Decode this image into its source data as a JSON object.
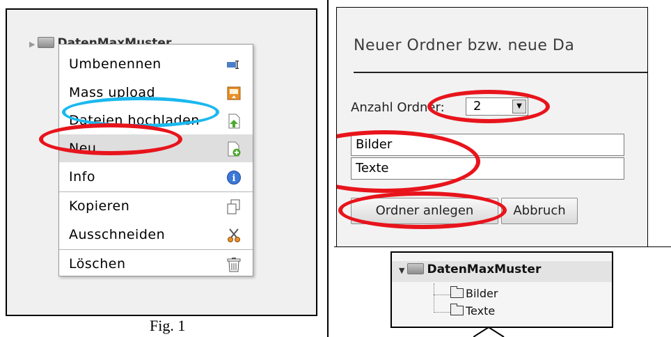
{
  "panel1": {
    "tree_root": "DatenMaxMuster",
    "context_menu": {
      "items": [
        {
          "label": "Umbenennen",
          "icon": "rename-icon"
        },
        {
          "label": "Mass upload",
          "icon": "mass-upload-icon"
        },
        {
          "label": "Dateien hochladen",
          "icon": "upload-file-icon"
        },
        {
          "label": "Neu",
          "icon": "new-file-icon"
        },
        {
          "label": "Info",
          "icon": "info-icon"
        },
        {
          "label": "Kopieren",
          "icon": "copy-icon"
        },
        {
          "label": "Ausschneiden",
          "icon": "scissors-icon"
        },
        {
          "label": "Löschen",
          "icon": "trash-icon"
        }
      ]
    },
    "caption": "Fig. 1"
  },
  "panel2": {
    "title": "Neuer Ordner bzw. neue Da",
    "count_label": "Anzahl Ordner:",
    "count_value": "2",
    "inputs": [
      "Bilder",
      "Texte"
    ],
    "create_button": "Ordner anlegen",
    "cancel_button": "Abbruch"
  },
  "panel3": {
    "tree_root": "DatenMaxMuster",
    "children": [
      "Bilder",
      "Texte"
    ]
  },
  "annotation_colors": {
    "red": "#e8141c",
    "blue": "#1ab8ee"
  }
}
